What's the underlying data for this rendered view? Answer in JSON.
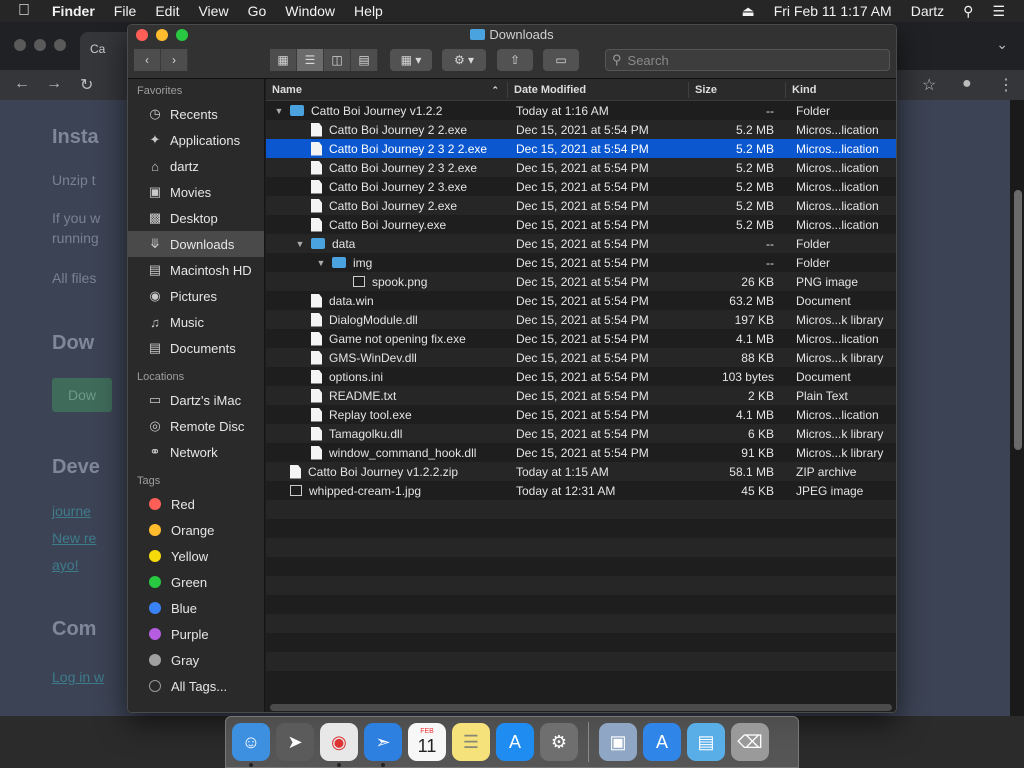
{
  "menubar": {
    "app": "Finder",
    "items": [
      "File",
      "Edit",
      "View",
      "Go",
      "Window",
      "Help"
    ],
    "clock": "Fri Feb 11  1:17 AM",
    "user": "Dartz"
  },
  "browser": {
    "tab_title": "Ca",
    "page": {
      "heading1": "Insta",
      "text1": "Unzip t",
      "text2": "If you w",
      "text3": "running",
      "text4": "All files",
      "heading2": "Dow",
      "download_button": "Dow",
      "heading3": "Deve",
      "link1": "journe",
      "link2": "New re",
      "link3": "ayo!",
      "heading4": "Com",
      "link4": "Log in w"
    }
  },
  "finder": {
    "title": "Downloads",
    "search_placeholder": "Search",
    "sidebar": {
      "favorites_header": "Favorites",
      "favorites": [
        {
          "label": "Recents",
          "icon": "clock-icon"
        },
        {
          "label": "Applications",
          "icon": "applications-icon"
        },
        {
          "label": "dartz",
          "icon": "home-icon"
        },
        {
          "label": "Movies",
          "icon": "movies-icon"
        },
        {
          "label": "Desktop",
          "icon": "desktop-icon"
        },
        {
          "label": "Downloads",
          "icon": "downloads-icon"
        },
        {
          "label": "Macintosh HD",
          "icon": "harddisk-icon"
        },
        {
          "label": "Pictures",
          "icon": "camera-icon"
        },
        {
          "label": "Music",
          "icon": "music-icon"
        },
        {
          "label": "Documents",
          "icon": "documents-icon"
        }
      ],
      "locations_header": "Locations",
      "locations": [
        {
          "label": "Dartz's iMac",
          "icon": "imac-icon"
        },
        {
          "label": "Remote Disc",
          "icon": "disc-icon"
        },
        {
          "label": "Network",
          "icon": "network-icon"
        }
      ],
      "tags_header": "Tags",
      "tags": [
        {
          "label": "Red",
          "color": "#ff5f57"
        },
        {
          "label": "Orange",
          "color": "#febc2e"
        },
        {
          "label": "Yellow",
          "color": "#f5d90a"
        },
        {
          "label": "Green",
          "color": "#28c840"
        },
        {
          "label": "Blue",
          "color": "#3b82f6"
        },
        {
          "label": "Purple",
          "color": "#b65ce0"
        },
        {
          "label": "Gray",
          "color": "#a0a0a0"
        },
        {
          "label": "All Tags...",
          "color": ""
        }
      ]
    },
    "columns": {
      "name": "Name",
      "date": "Date Modified",
      "size": "Size",
      "kind": "Kind"
    },
    "files": [
      {
        "name": "Catto Boi Journey v1.2.2",
        "date": "Today at 1:16 AM",
        "size": "--",
        "kind": "Folder",
        "type": "folder",
        "depth": 0,
        "expanded": true
      },
      {
        "name": "Catto Boi Journey 2 2.exe",
        "date": "Dec 15, 2021 at 5:54 PM",
        "size": "5.2 MB",
        "kind": "Micros...lication",
        "type": "file",
        "depth": 1
      },
      {
        "name": "Catto Boi Journey 2 3 2 2.exe",
        "date": "Dec 15, 2021 at 5:54 PM",
        "size": "5.2 MB",
        "kind": "Micros...lication",
        "type": "file",
        "depth": 1,
        "selected": true
      },
      {
        "name": "Catto Boi Journey 2 3 2.exe",
        "date": "Dec 15, 2021 at 5:54 PM",
        "size": "5.2 MB",
        "kind": "Micros...lication",
        "type": "file",
        "depth": 1
      },
      {
        "name": "Catto Boi Journey 2 3.exe",
        "date": "Dec 15, 2021 at 5:54 PM",
        "size": "5.2 MB",
        "kind": "Micros...lication",
        "type": "file",
        "depth": 1
      },
      {
        "name": "Catto Boi Journey 2.exe",
        "date": "Dec 15, 2021 at 5:54 PM",
        "size": "5.2 MB",
        "kind": "Micros...lication",
        "type": "file",
        "depth": 1
      },
      {
        "name": "Catto Boi Journey.exe",
        "date": "Dec 15, 2021 at 5:54 PM",
        "size": "5.2 MB",
        "kind": "Micros...lication",
        "type": "file",
        "depth": 1
      },
      {
        "name": "data",
        "date": "Dec 15, 2021 at 5:54 PM",
        "size": "--",
        "kind": "Folder",
        "type": "folder",
        "depth": 1,
        "expanded": true
      },
      {
        "name": "img",
        "date": "Dec 15, 2021 at 5:54 PM",
        "size": "--",
        "kind": "Folder",
        "type": "folder",
        "depth": 2,
        "expanded": true
      },
      {
        "name": "spook.png",
        "date": "Dec 15, 2021 at 5:54 PM",
        "size": "26 KB",
        "kind": "PNG image",
        "type": "image",
        "depth": 3
      },
      {
        "name": "data.win",
        "date": "Dec 15, 2021 at 5:54 PM",
        "size": "63.2 MB",
        "kind": "Document",
        "type": "file",
        "depth": 1
      },
      {
        "name": "DialogModule.dll",
        "date": "Dec 15, 2021 at 5:54 PM",
        "size": "197 KB",
        "kind": "Micros...k library",
        "type": "file",
        "depth": 1
      },
      {
        "name": "Game not opening fix.exe",
        "date": "Dec 15, 2021 at 5:54 PM",
        "size": "4.1 MB",
        "kind": "Micros...lication",
        "type": "file",
        "depth": 1
      },
      {
        "name": "GMS-WinDev.dll",
        "date": "Dec 15, 2021 at 5:54 PM",
        "size": "88 KB",
        "kind": "Micros...k library",
        "type": "file",
        "depth": 1
      },
      {
        "name": "options.ini",
        "date": "Dec 15, 2021 at 5:54 PM",
        "size": "103 bytes",
        "kind": "Document",
        "type": "file",
        "depth": 1
      },
      {
        "name": "README.txt",
        "date": "Dec 15, 2021 at 5:54 PM",
        "size": "2 KB",
        "kind": "Plain Text",
        "type": "file",
        "depth": 1
      },
      {
        "name": "Replay tool.exe",
        "date": "Dec 15, 2021 at 5:54 PM",
        "size": "4.1 MB",
        "kind": "Micros...lication",
        "type": "file",
        "depth": 1
      },
      {
        "name": "Tamagolku.dll",
        "date": "Dec 15, 2021 at 5:54 PM",
        "size": "6 KB",
        "kind": "Micros...k library",
        "type": "file",
        "depth": 1
      },
      {
        "name": "window_command_hook.dll",
        "date": "Dec 15, 2021 at 5:54 PM",
        "size": "91 KB",
        "kind": "Micros...k library",
        "type": "file",
        "depth": 1
      },
      {
        "name": "Catto Boi Journey v1.2.2.zip",
        "date": "Today at 1:15 AM",
        "size": "58.1 MB",
        "kind": "ZIP archive",
        "type": "file",
        "depth": 0
      },
      {
        "name": "whipped-cream-1.jpg",
        "date": "Today at 12:31 AM",
        "size": "45 KB",
        "kind": "JPEG image",
        "type": "image",
        "depth": 0
      }
    ]
  },
  "dock": {
    "items": [
      {
        "name": "finder-icon",
        "color": "#3d8fe0",
        "running": true
      },
      {
        "name": "launchpad-icon",
        "color": "#5b5b5b",
        "running": false
      },
      {
        "name": "chrome-icon",
        "color": "#e8e8e8",
        "running": true
      },
      {
        "name": "safari-icon",
        "color": "#2d7fe0",
        "running": true
      },
      {
        "name": "calendar-icon",
        "color": "#f7f7f7",
        "running": false
      },
      {
        "name": "notes-icon",
        "color": "#f6e27a",
        "running": false
      },
      {
        "name": "app-store-icon",
        "color": "#1e8cf0",
        "running": false
      },
      {
        "name": "system-preferences-icon",
        "color": "#6f6f6f",
        "running": false
      },
      {
        "name": "preview-icon",
        "color": "#8fa7c4",
        "running": false
      },
      {
        "name": "applications-folder-icon",
        "color": "#2f86e8",
        "running": false
      },
      {
        "name": "downloads-folder-icon",
        "color": "#5aaee8",
        "running": false
      },
      {
        "name": "trash-icon",
        "color": "#9a9a9a",
        "running": false
      }
    ],
    "calendar": {
      "month": "FEB",
      "day": "11"
    }
  }
}
